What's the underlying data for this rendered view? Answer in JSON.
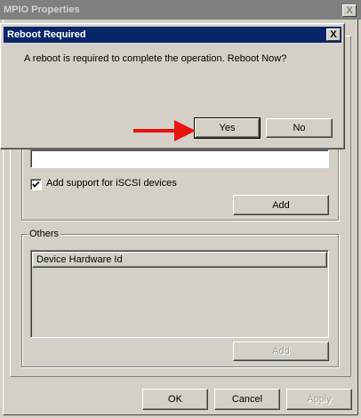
{
  "main_window": {
    "title": "MPIO Properties",
    "close_glyph": "X"
  },
  "dialog": {
    "title": "Reboot Required",
    "close_glyph": "X",
    "message": "A reboot is required to complete the operation. Reboot Now?",
    "yes_label": "Yes",
    "no_label": "No"
  },
  "iscsi": {
    "checkbox_label": "Add support for iSCSI devices",
    "checkbox_checked": true,
    "add_label": "Add"
  },
  "others": {
    "group_label": "Others",
    "list_header": "Device Hardware Id",
    "add_label": "Add"
  },
  "footer": {
    "ok_label": "OK",
    "cancel_label": "Cancel",
    "apply_label": "Apply"
  },
  "annotation": {
    "arrow_color": "#e8140f"
  }
}
